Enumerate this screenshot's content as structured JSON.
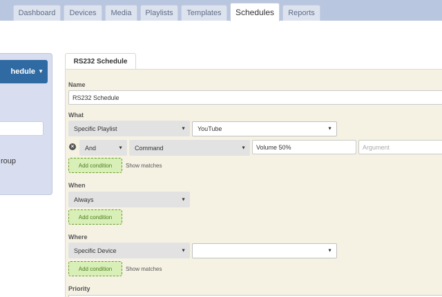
{
  "tabs": [
    {
      "label": "Dashboard",
      "active": false
    },
    {
      "label": "Devices",
      "active": false
    },
    {
      "label": "Media",
      "active": false
    },
    {
      "label": "Playlists",
      "active": false
    },
    {
      "label": "Templates",
      "active": false
    },
    {
      "label": "Schedules",
      "active": true
    },
    {
      "label": "Reports",
      "active": false
    }
  ],
  "sidebar": {
    "schedule_button": "hedule",
    "caret": "▼",
    "group_label": "roup"
  },
  "form": {
    "panel_tab": "RS232 Schedule",
    "name": {
      "label": "Name",
      "value": "RS232 Schedule"
    },
    "what": {
      "label": "What",
      "type_select": "Specific Playlist",
      "playlist_select": "YouTube",
      "condition": {
        "conjunction": "And",
        "field": "Command",
        "value": "Volume 50%",
        "argument_placeholder": "Argument"
      },
      "add_condition": "Add condition",
      "show_matches": "Show matches"
    },
    "when": {
      "label": "When",
      "select": "Always",
      "add_condition": "Add condition"
    },
    "where": {
      "label": "Where",
      "type_select": "Specific Device",
      "device_select": "",
      "add_condition": "Add condition",
      "show_matches": "Show matches"
    },
    "priority": {
      "label": "Priority"
    }
  },
  "colors": {
    "topbar": "#b9c6e0",
    "accent": "#2f6aa2",
    "panel": "#f5f2e4",
    "add_condition": "#d9efb8"
  }
}
